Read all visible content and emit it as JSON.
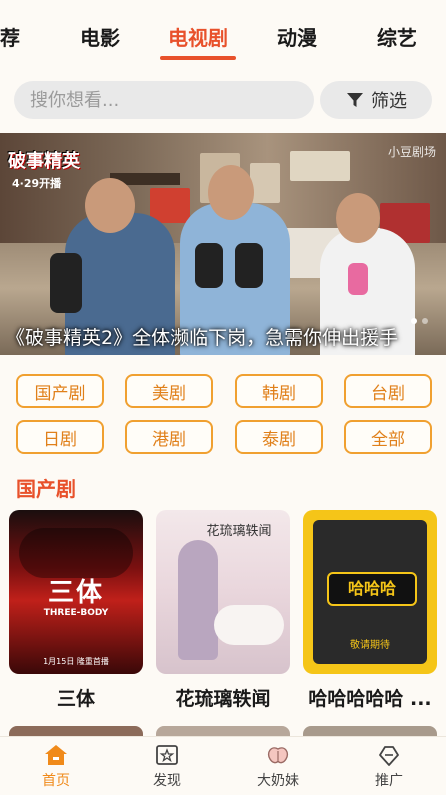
{
  "tabs": [
    {
      "label": "荐"
    },
    {
      "label": "电影"
    },
    {
      "label": "电视剧",
      "active": true
    },
    {
      "label": "动漫"
    },
    {
      "label": "综艺"
    }
  ],
  "search": {
    "placeholder": "搜你想看..."
  },
  "filter": {
    "label": "筛选",
    "icon": "funnel-icon"
  },
  "banner": {
    "logo_text": "破事精英",
    "date_text": "4·29开播",
    "brand_text": "小豆剧场",
    "caption": "《破事精英2》全体濒临下岗，急需你伸出援手",
    "slides": 2,
    "active_slide": 0
  },
  "regions": [
    {
      "label": "国产剧"
    },
    {
      "label": "美剧"
    },
    {
      "label": "韩剧"
    },
    {
      "label": "台剧"
    },
    {
      "label": "日剧"
    },
    {
      "label": "港剧"
    },
    {
      "label": "泰剧"
    },
    {
      "label": "全部"
    }
  ],
  "section": {
    "title": "国产剧",
    "items": [
      {
        "title": "三体",
        "poster_text": "三体",
        "poster_sub": "THREE-BODY",
        "poster_date": "1月15日 隆重首播"
      },
      {
        "title": "花琉璃轶闻",
        "poster_text": "花琉璃轶闻"
      },
      {
        "title": "哈哈哈哈哈 ...",
        "poster_text": "哈哈哈",
        "poster_sub": "敬请期待"
      }
    ]
  },
  "bottom_nav": [
    {
      "label": "首页",
      "icon": "home-icon",
      "active": true
    },
    {
      "label": "发现",
      "icon": "discover-icon"
    },
    {
      "label": "大奶妹",
      "icon": "peach-icon"
    },
    {
      "label": "推广",
      "icon": "share-icon"
    }
  ],
  "colors": {
    "accent": "#e8512b",
    "chip_border": "#f0a030",
    "nav_active": "#f08a1a"
  }
}
